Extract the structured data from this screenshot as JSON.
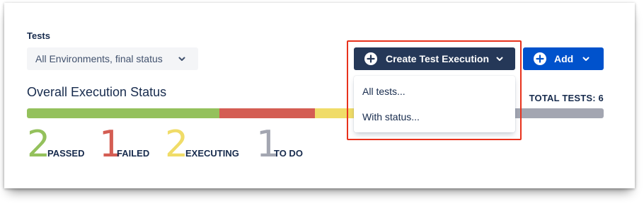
{
  "panel": {
    "tests_label": "Tests",
    "environment_filter": "All Environments, final status",
    "create_button_label": "Create Test Execution",
    "add_button_label": "Add",
    "overall_title": "Overall Execution Status",
    "total_tests": "TOTAL TESTS: 6"
  },
  "dropdown": {
    "items": [
      {
        "label": "All tests..."
      },
      {
        "label": "With status..."
      }
    ]
  },
  "status": {
    "items": [
      {
        "count": "2",
        "label": "PASSED",
        "color": "#94c15c"
      },
      {
        "count": "1",
        "label": "FAILED",
        "color": "#d45d53"
      },
      {
        "count": "2",
        "label": "EXECUTING",
        "color": "#f0dc68"
      },
      {
        "count": "1",
        "label": "TO DO",
        "color": "#a3a6b1"
      }
    ]
  },
  "colors": {
    "create_button_bg": "#253858",
    "add_button_bg": "#0052cc",
    "highlight_border": "#e8321c"
  }
}
